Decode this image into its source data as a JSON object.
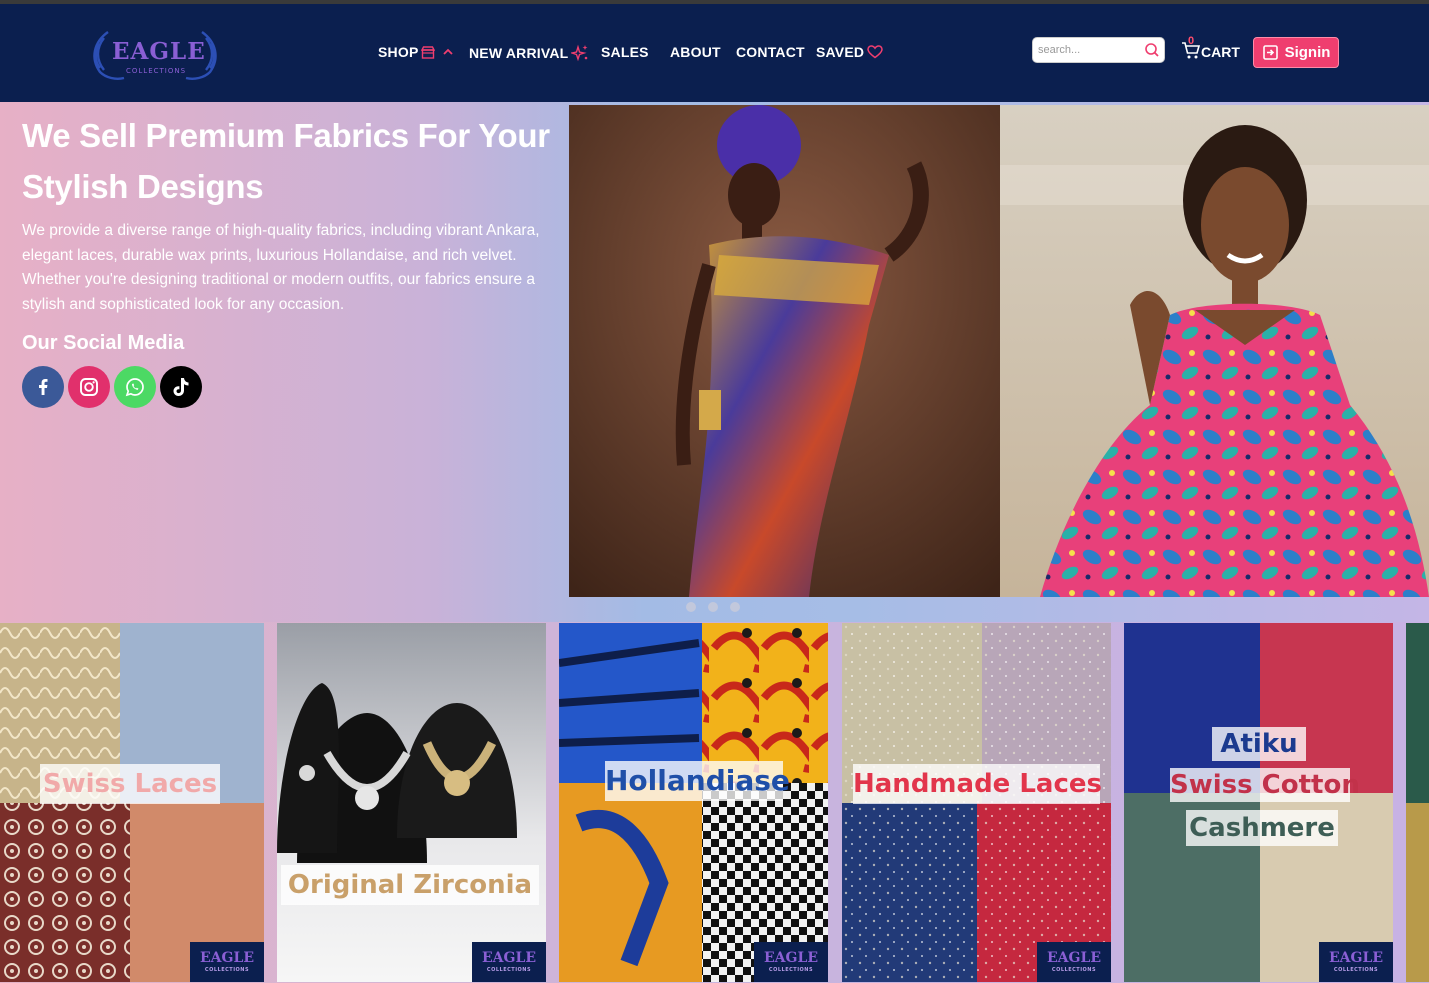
{
  "brand": {
    "name": "EAGLE",
    "tagline": "COLLECTIONS",
    "accent": "#8a5fd4",
    "header_bg": "#0b1f4f",
    "signin_color": "#ef3e6f"
  },
  "nav": {
    "items": [
      {
        "label": "SHOP",
        "icon": "store-icon",
        "extra_icon": "chevron-up-icon"
      },
      {
        "label": "NEW ARRIVAL",
        "icon": "sparkle-icon"
      },
      {
        "label": "SALES"
      },
      {
        "label": "ABOUT"
      },
      {
        "label": "CONTACT"
      },
      {
        "label": "SAVED",
        "icon": "heart-icon"
      }
    ]
  },
  "search": {
    "placeholder": "search...",
    "value": ""
  },
  "cart": {
    "label": "CART",
    "count": "0"
  },
  "signin": {
    "label": "Signin"
  },
  "hero": {
    "title": "We Sell Premium Fabrics For Your Stylish Designs",
    "text": "We provide a diverse range of high-quality fabrics, including vibrant Ankara, elegant laces, durable wax prints, luxurious Hollandaise, and rich velvet. Whether you're designing traditional or modern outfits, our fabrics ensure a stylish and sophisticated look for any occasion.",
    "social_title": "Our Social Media",
    "socials": [
      {
        "name": "facebook",
        "icon": "facebook-icon",
        "color": "#3b5998"
      },
      {
        "name": "instagram",
        "icon": "instagram-icon",
        "color": "#e1306c"
      },
      {
        "name": "whatsapp",
        "icon": "whatsapp-icon",
        "color": "#4cd964"
      },
      {
        "name": "tiktok",
        "icon": "tiktok-icon",
        "color": "#000000"
      }
    ],
    "slides_total": 3
  },
  "products": [
    {
      "lines": [
        "Swiss Laces"
      ],
      "label_color": "#f1a9a9"
    },
    {
      "lines": [
        "Original Zirconia"
      ],
      "label_color": "#c9a06a"
    },
    {
      "lines": [
        "Hollandiase"
      ],
      "label_color": "#1f4fa8"
    },
    {
      "lines": [
        "Handmade Laces"
      ],
      "label_color": "#e2354b"
    },
    {
      "lines": [
        "Atiku",
        "Swiss Cotton",
        "Cashmere"
      ],
      "label_color": "#1b3a8f"
    }
  ],
  "badge": {
    "name": "EAGLE",
    "sub": "COLLECTIONS"
  }
}
